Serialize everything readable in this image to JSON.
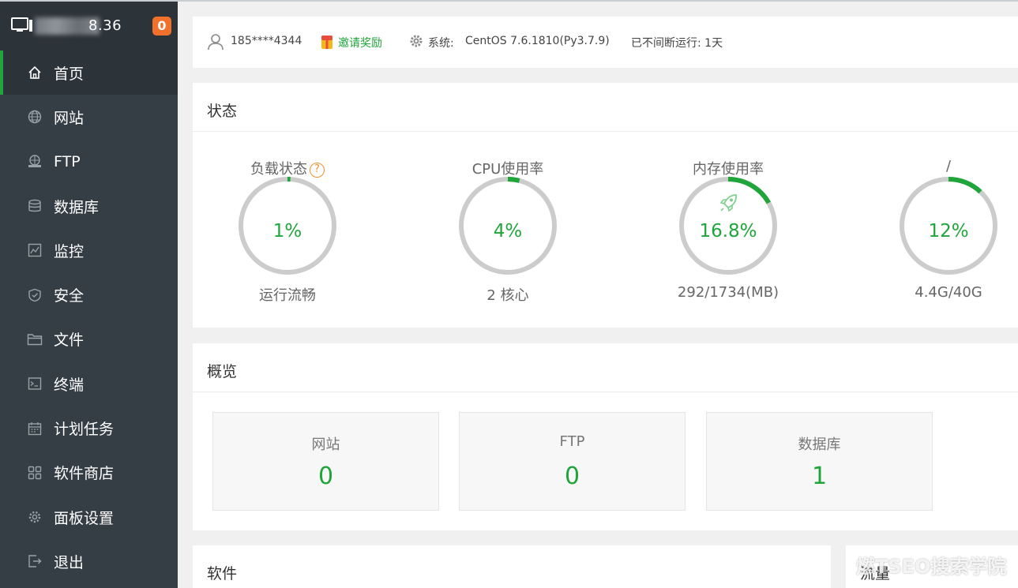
{
  "sidebar": {
    "server_ip": "8.36",
    "badge_count": "0",
    "items": [
      {
        "label": "首页",
        "icon": "home-icon",
        "active": true
      },
      {
        "label": "网站",
        "icon": "globe-icon"
      },
      {
        "label": "FTP",
        "icon": "ftp-icon"
      },
      {
        "label": "数据库",
        "icon": "database-icon"
      },
      {
        "label": "监控",
        "icon": "monitor-chart-icon"
      },
      {
        "label": "安全",
        "icon": "shield-icon"
      },
      {
        "label": "文件",
        "icon": "folder-icon"
      },
      {
        "label": "终端",
        "icon": "terminal-icon"
      },
      {
        "label": "计划任务",
        "icon": "calendar-icon"
      },
      {
        "label": "软件商店",
        "icon": "grid-icon"
      },
      {
        "label": "面板设置",
        "icon": "gear-icon"
      },
      {
        "label": "退出",
        "icon": "logout-icon"
      }
    ]
  },
  "infobar": {
    "phone": "185****4344",
    "invite": "邀请奖励",
    "system_label": "系统:",
    "system_value": "CentOS 7.6.1810(Py3.7.9)",
    "uptime": "已不间断运行: 1天"
  },
  "status": {
    "title": "状态",
    "gauges": [
      {
        "title": "负载状态",
        "value": "1%",
        "percent": 1,
        "sub": "运行流畅",
        "help": "?"
      },
      {
        "title": "CPU使用率",
        "value": "4%",
        "percent": 4,
        "sub": "2 核心"
      },
      {
        "title": "内存使用率",
        "value": "16.8%",
        "percent": 16.8,
        "sub": "292/1734(MB)"
      },
      {
        "title": "/",
        "value": "12%",
        "percent": 12,
        "sub": "4.4G/40G"
      }
    ]
  },
  "overview": {
    "title": "概览",
    "boxes": [
      {
        "label": "网站",
        "value": "0"
      },
      {
        "label": "FTP",
        "value": "0"
      },
      {
        "label": "数据库",
        "value": "1"
      }
    ]
  },
  "software": {
    "title": "软件"
  },
  "traffic": {
    "title": "流量"
  },
  "watermark": "燃TSEO搜索学院",
  "colors": {
    "accent": "#20a53a",
    "sidebar": "#363e45",
    "badge": "#f0702c",
    "track": "#cccccc"
  }
}
